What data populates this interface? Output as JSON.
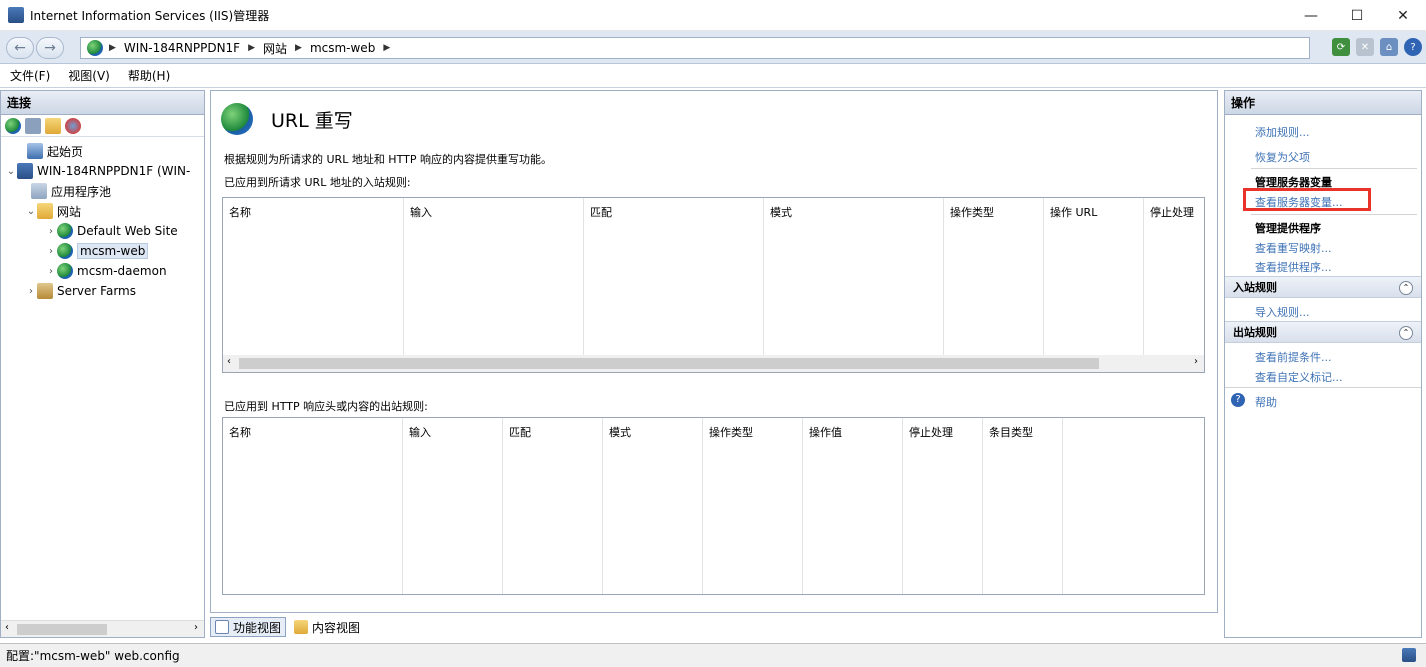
{
  "window": {
    "title": "Internet Information Services (IIS)管理器",
    "minimize": "—",
    "maximize": "☐",
    "close": "✕"
  },
  "address": {
    "crumbs": [
      "WIN-184RNPPDN1F",
      "网站",
      "mcsm-web"
    ]
  },
  "menu": {
    "items": [
      "文件(F)",
      "视图(V)",
      "帮助(H)"
    ]
  },
  "connections": {
    "header": "连接",
    "tree": {
      "start_page": "起始页",
      "server": "WIN-184RNPPDN1F (WIN-",
      "app_pools": "应用程序池",
      "sites": "网站",
      "default_site": "Default Web Site",
      "mcsm_web": "mcsm-web",
      "mcsm_daemon": "mcsm-daemon",
      "server_farms": "Server Farms"
    }
  },
  "center": {
    "title": "URL 重写",
    "description": "根据规则为所请求的 URL 地址和 HTTP 响应的内容提供重写功能。",
    "inbound_title": "已应用到所请求 URL 地址的入站规则:",
    "inbound_columns": [
      "名称",
      "输入",
      "匹配",
      "模式",
      "操作类型",
      "操作 URL",
      "停止处理"
    ],
    "outbound_title": "已应用到 HTTP 响应头或内容的出站规则:",
    "outbound_columns": [
      "名称",
      "输入",
      "匹配",
      "模式",
      "操作类型",
      "操作值",
      "停止处理",
      "条目类型"
    ]
  },
  "view_tabs": {
    "feature_view": "功能视图",
    "content_view": "内容视图"
  },
  "actions": {
    "header": "操作",
    "add_rule": "添加规则...",
    "revert_parent": "恢复为父项",
    "manage_server_vars": "管理服务器变量",
    "view_server_vars": "查看服务器变量...",
    "manage_providers": "管理提供程序",
    "view_rewrite_maps": "查看重写映射...",
    "view_providers": "查看提供程序...",
    "inbound_section": "入站规则",
    "import_rules": "导入规则...",
    "outbound_section": "出站规则",
    "view_preconditions": "查看前提条件...",
    "view_custom_tags": "查看自定义标记...",
    "help": "帮助"
  },
  "status": {
    "config": "配置:\"mcsm-web\" web.config"
  },
  "colors": {
    "link": "#3e72b5",
    "highlight": "#e8322a"
  }
}
